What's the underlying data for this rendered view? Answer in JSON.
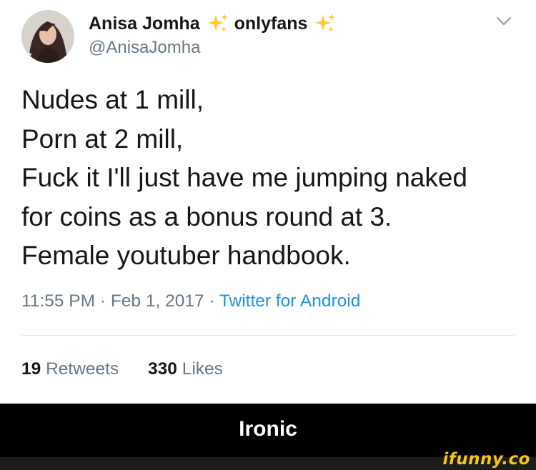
{
  "tweet": {
    "author": {
      "name": "Anisa Jomha",
      "name_suffix": "onlyfans",
      "handle": "@AnisaJomha",
      "badge_icon": "sparkles-icon"
    },
    "menu_icon": "chevron-down-icon",
    "text_lines": [
      "Nudes at 1 mill,",
      "Porn at 2 mill,",
      "Fuck it I'll just have me jumping naked",
      "for coins as a bonus round at 3.",
      "Female youtuber handbook."
    ],
    "timestamp": "11:55 PM · Feb 1, 2017 · ",
    "source": "Twitter for Android",
    "stats": {
      "retweets_count": "19",
      "retweets_label": "Retweets",
      "likes_count": "330",
      "likes_label": "Likes"
    }
  },
  "caption": "Ironic",
  "watermark": "ifunny.co",
  "colors": {
    "text_primary": "#14171a",
    "text_secondary": "#657786",
    "link": "#1b95e0",
    "sparkle": "#ffcc33",
    "caption_bg": "#000000",
    "watermark": "#f5c518"
  }
}
